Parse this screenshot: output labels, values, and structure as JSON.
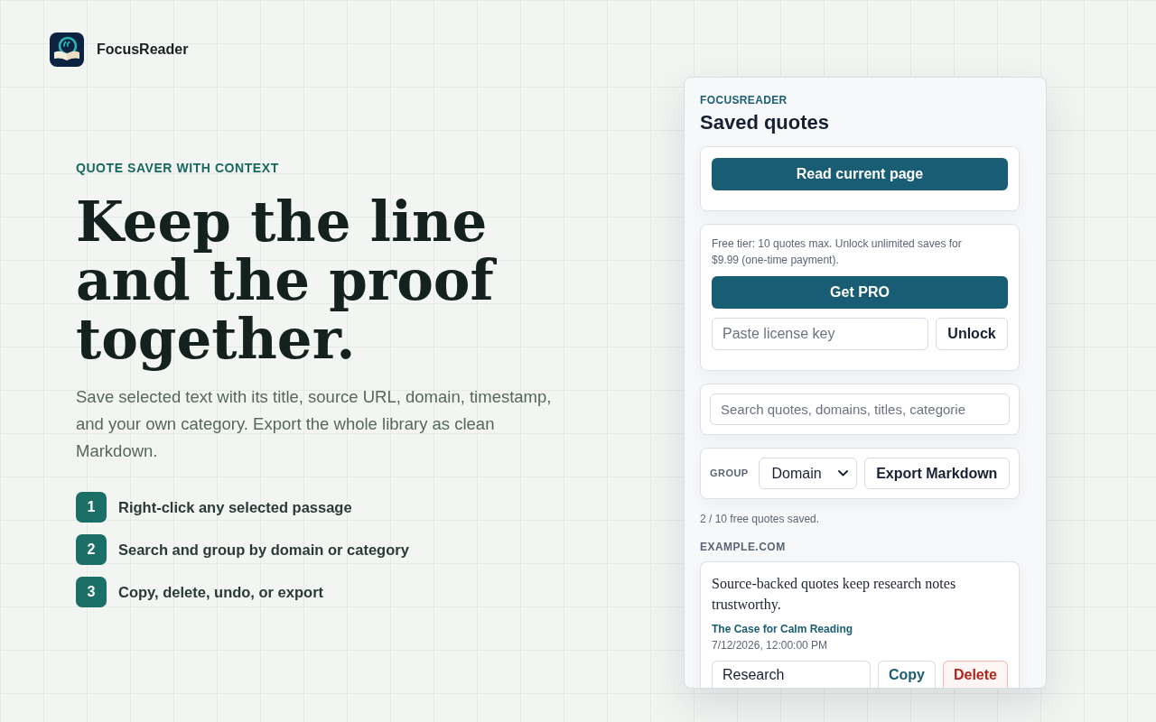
{
  "brand": {
    "name": "FocusReader"
  },
  "hero": {
    "eyebrow": "QUOTE SAVER WITH CONTEXT",
    "headline": "Keep the line and the proof together.",
    "description": "Save selected text with its title, source URL, domain, timestamp, and your own category. Export the whole library as clean Markdown.",
    "steps": [
      {
        "number": "1",
        "text": "Right-click any selected passage"
      },
      {
        "number": "2",
        "text": "Search and group by domain or category"
      },
      {
        "number": "3",
        "text": "Copy, delete, undo, or export"
      }
    ]
  },
  "panel": {
    "eyebrow": "FOCUSREADER",
    "title": "Saved quotes",
    "read_button": "Read current page",
    "pro": {
      "note": "Free tier: 10 quotes max. Unlock unlimited saves for $9.99 (one-time payment).",
      "get_pro_button": "Get PRO",
      "license_field": {
        "placeholder": "Paste license key"
      },
      "unlock_button": "Unlock"
    },
    "search": {
      "placeholder": "Search quotes, domains, titles, categorie"
    },
    "group": {
      "label": "GROUP",
      "value": "Domain"
    },
    "export_button": "Export Markdown",
    "usage": "2 / 10 free quotes saved.",
    "groups": [
      {
        "heading": "EXAMPLE.COM",
        "quotes": [
          {
            "text": "Source-backed quotes keep research notes trustworthy.",
            "title": "The Case for Calm Reading",
            "timestamp": "7/12/2026, 12:00:00 PM",
            "category": {
              "value": "Research"
            },
            "copy_button": "Copy",
            "delete_button": "Delete"
          }
        ]
      }
    ]
  }
}
